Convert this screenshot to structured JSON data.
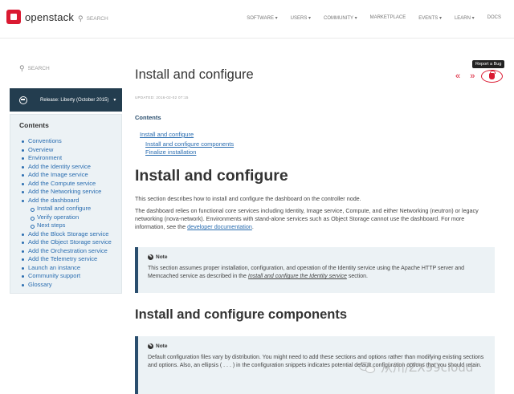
{
  "header": {
    "logo_text": "openstack",
    "search_label": "SEARCH",
    "nav": [
      "SOFTWARE ▾",
      "USERS ▾",
      "COMMUNITY ▾",
      "MARKETPLACE",
      "EVENTS ▾",
      "LEARN ▾",
      "DOCS"
    ]
  },
  "sidebar": {
    "search_label": "SEARCH",
    "release_label": "Release: Liberty (October 2015)",
    "contents_title": "Contents",
    "items": [
      {
        "label": "Conventions",
        "level": 0
      },
      {
        "label": "Overview",
        "level": 0
      },
      {
        "label": "Environment",
        "level": 0
      },
      {
        "label": "Add the Identity service",
        "level": 0
      },
      {
        "label": "Add the Image service",
        "level": 0
      },
      {
        "label": "Add the Compute service",
        "level": 0
      },
      {
        "label": "Add the Networking service",
        "level": 0
      },
      {
        "label": "Add the dashboard",
        "level": 0
      },
      {
        "label": "Install and configure",
        "level": 1
      },
      {
        "label": "Verify operation",
        "level": 1
      },
      {
        "label": "Next steps",
        "level": 1
      },
      {
        "label": "Add the Block Storage service",
        "level": 0
      },
      {
        "label": "Add the Object Storage service",
        "level": 0
      },
      {
        "label": "Add the Orchestration service",
        "level": 0
      },
      {
        "label": "Add the Telemetry service",
        "level": 0
      },
      {
        "label": "Launch an instance",
        "level": 0
      },
      {
        "label": "Community support",
        "level": 0
      },
      {
        "label": "Glossary",
        "level": 0
      }
    ]
  },
  "page": {
    "title": "Install and configure",
    "updated": "UPDATED: 2016-02-02 07:15",
    "tooltip": "Report a Bug",
    "prev_label": "«",
    "next_label": "»",
    "contents_title": "Contents",
    "contents_links": [
      "Install and configure",
      "Install and configure components",
      "Finalize installation"
    ],
    "section_title": "Install and configure",
    "intro": "This section describes how to install and configure the dashboard on the controller node.",
    "para_text": "The dashboard relies on functional core services including Identity, Image service, Compute, and either Networking (neutron) or legacy networking (nova-network). Environments with stand-alone services such as Object Storage cannot use the dashboard. For more information, see the ",
    "para_link": "developer documentation",
    "para_end": ".",
    "note1": {
      "heading": "Note",
      "text": "This section assumes proper installation, configuration, and operation of the Identity service using the Apache HTTP server and Memcached service as described in the ",
      "link": "Install and configure the Identity service",
      "end": " section."
    },
    "components_title": "Install and configure components",
    "note2": {
      "heading": "Note",
      "text": "Default configuration files vary by distribution. You might need to add these sections and options rather than modifying existing sections and options. Also, an ellipsis ( . . . ) in the configuration snippets indicates potential default configuration options that you should retain."
    }
  },
  "watermark": {
    "text": "从川/ZX99cloud"
  },
  "colors": {
    "brand_red": "#da1a32",
    "navy": "#233d4f",
    "link": "#2a6db0",
    "panel": "#ecf2f5"
  }
}
